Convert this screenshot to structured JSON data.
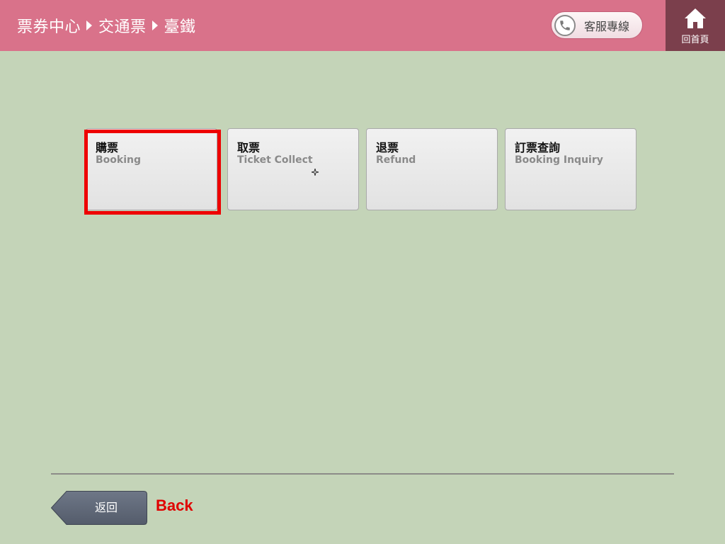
{
  "header": {
    "breadcrumb": [
      "票券中心",
      "交通票",
      "臺鐵"
    ],
    "hotline_label": "客服專線",
    "home_label": "回首頁"
  },
  "tiles": [
    {
      "zh": "購票",
      "en": "Booking"
    },
    {
      "zh": "取票",
      "en": "Ticket Collect"
    },
    {
      "zh": "退票",
      "en": "Refund"
    },
    {
      "zh": "訂票查詢",
      "en": "Booking Inquiry"
    }
  ],
  "footer": {
    "back_button_label": "返回",
    "back_annotation": "Back"
  },
  "colors": {
    "header_bg": "#d9728a",
    "home_bg": "#7b3f4c",
    "page_bg": "#c4d4b8",
    "highlight": "#ee0000",
    "back_button": "#5f6878"
  },
  "icons": [
    "phone-icon",
    "home-icon",
    "cursor-icon"
  ]
}
